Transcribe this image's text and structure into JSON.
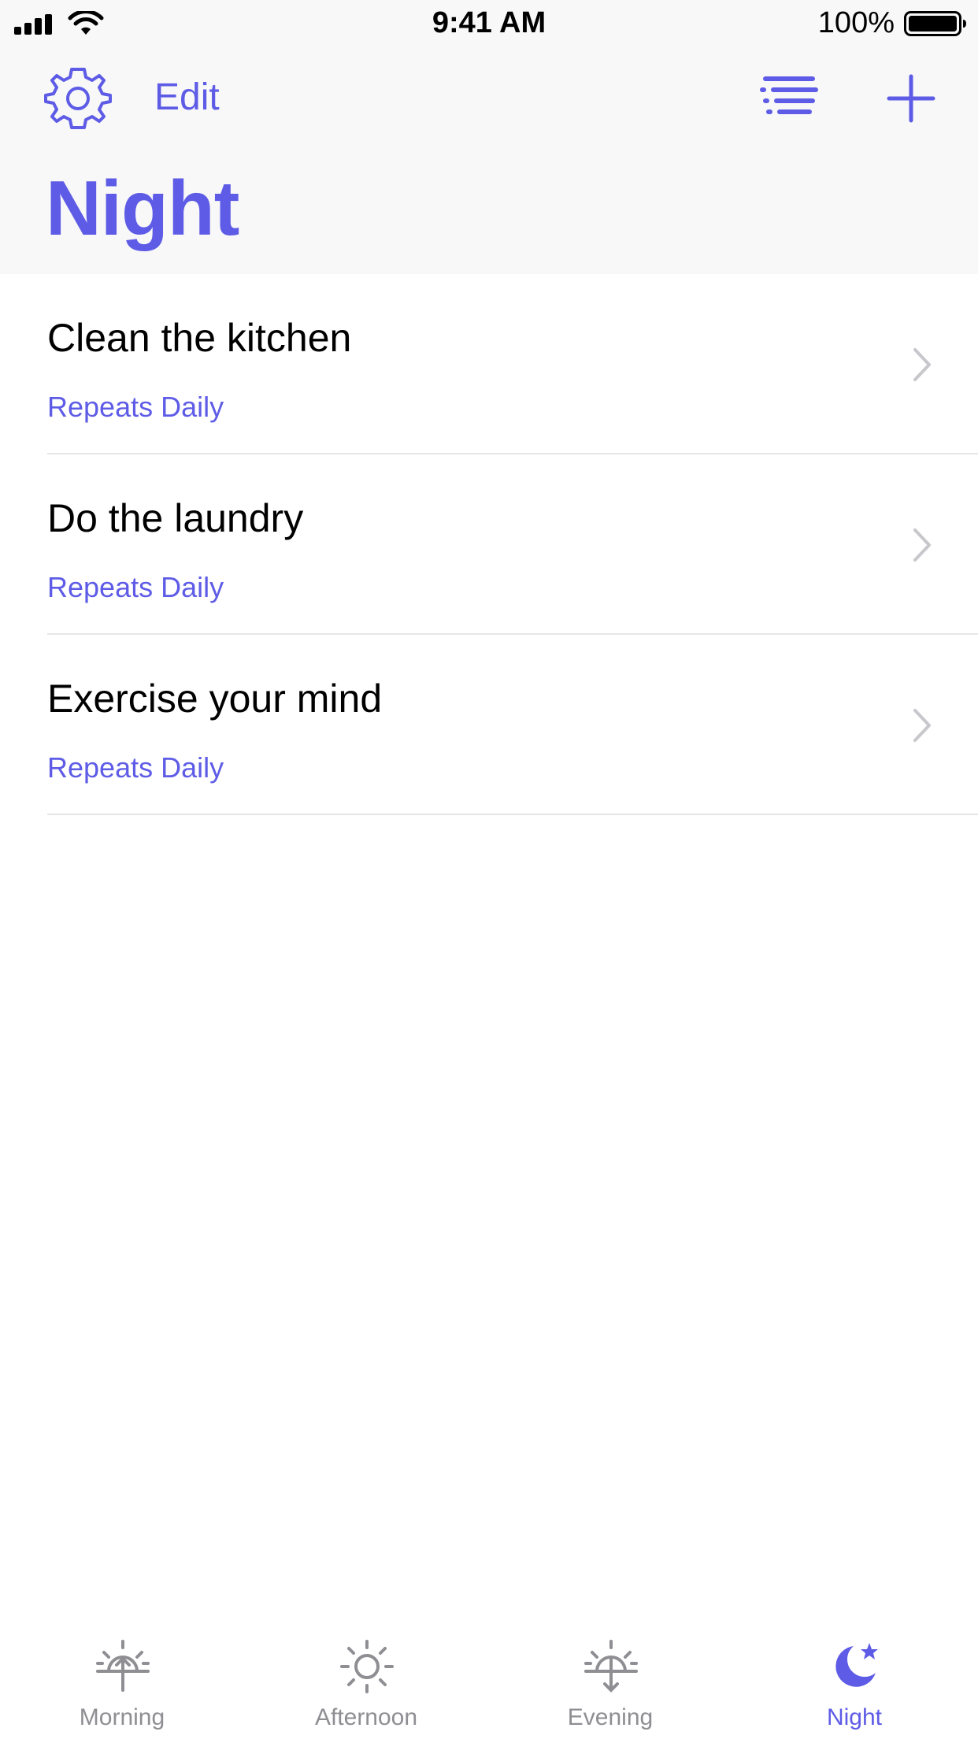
{
  "status": {
    "time": "9:41 AM",
    "battery": "100%"
  },
  "nav": {
    "edit_label": "Edit",
    "title": "Night"
  },
  "tasks": [
    {
      "title": "Clean the kitchen",
      "repeat": "Repeats Daily"
    },
    {
      "title": "Do the laundry",
      "repeat": "Repeats Daily"
    },
    {
      "title": "Exercise your mind",
      "repeat": "Repeats Daily"
    }
  ],
  "tabs": [
    {
      "label": "Morning",
      "icon": "sunrise-icon",
      "active": false
    },
    {
      "label": "Afternoon",
      "icon": "sun-icon",
      "active": false
    },
    {
      "label": "Evening",
      "icon": "sunset-icon",
      "active": false
    },
    {
      "label": "Night",
      "icon": "moon-star-icon",
      "active": true
    }
  ],
  "colors": {
    "accent": "#5e5ce6",
    "inactive": "#8e8e93",
    "chevron": "#c7c7cc"
  }
}
